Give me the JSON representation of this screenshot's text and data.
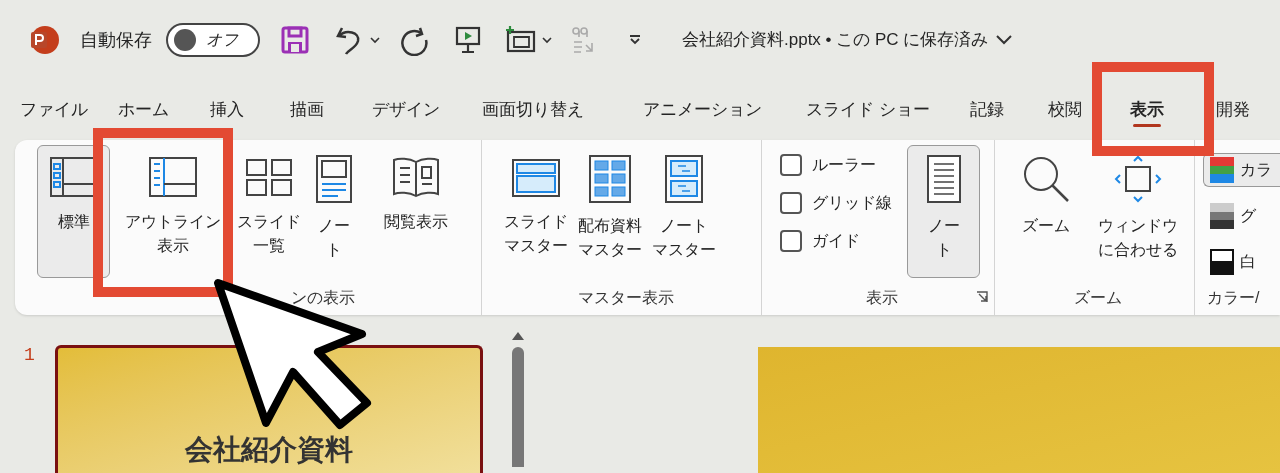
{
  "title_bar": {
    "autosave_label": "自動保存",
    "autosave_toggle": {
      "label": "オフ",
      "on": false
    },
    "file_title": "会社紹介資料.pptx • この PC に保存済み"
  },
  "tabs": [
    {
      "label": "ファイル",
      "selected": false
    },
    {
      "label": "ホーム",
      "selected": false
    },
    {
      "label": "挿入",
      "selected": false
    },
    {
      "label": "描画",
      "selected": false
    },
    {
      "label": "デザイン",
      "selected": false
    },
    {
      "label": "画面切り替え",
      "selected": false
    },
    {
      "label": "アニメーション",
      "selected": false
    },
    {
      "label": "スライド ショー",
      "selected": false
    },
    {
      "label": "記録",
      "selected": false
    },
    {
      "label": "校閲",
      "selected": false
    },
    {
      "label": "表示",
      "selected": true
    },
    {
      "label": "開発",
      "selected": false
    }
  ],
  "ribbon": {
    "groups": [
      {
        "label": "ンの表示",
        "items": [
          {
            "kind": "button",
            "lines": [
              "標準"
            ],
            "selected": true
          },
          {
            "kind": "button",
            "lines": [
              "アウトライン",
              "表示"
            ],
            "selected": false
          },
          {
            "kind": "button",
            "lines": [
              "スライド",
              "一覧"
            ],
            "selected": false
          },
          {
            "kind": "button",
            "lines": [
              "ノー",
              "ト"
            ],
            "selected": false
          },
          {
            "kind": "button",
            "lines": [
              "閲覧表示"
            ],
            "selected": false
          }
        ]
      },
      {
        "label": "マスター表示",
        "items": [
          {
            "kind": "button",
            "lines": [
              "スライド",
              "マスター"
            ],
            "selected": false
          },
          {
            "kind": "button",
            "lines": [
              "配布資料",
              "マスター"
            ],
            "selected": false
          },
          {
            "kind": "button",
            "lines": [
              "ノート",
              "マスター"
            ],
            "selected": false
          }
        ]
      },
      {
        "label": "表示",
        "items": [
          {
            "kind": "checkbox",
            "label": "ルーラー",
            "checked": false
          },
          {
            "kind": "checkbox",
            "label": "グリッド線",
            "checked": false
          },
          {
            "kind": "checkbox",
            "label": "ガイド",
            "checked": false
          },
          {
            "kind": "button",
            "lines": [
              "ノー",
              "ト"
            ],
            "selected": true
          }
        ]
      },
      {
        "label": "ズーム",
        "items": [
          {
            "kind": "button",
            "lines": [
              "ズーム"
            ],
            "selected": false
          },
          {
            "kind": "button",
            "lines": [
              "ウィンドウ",
              "に合わせる"
            ],
            "selected": false
          }
        ]
      },
      {
        "label": "カラー/",
        "items": [
          {
            "kind": "color-option",
            "label": "カラ",
            "selected": true
          },
          {
            "kind": "color-option",
            "label": "グ",
            "selected": false
          },
          {
            "kind": "color-option",
            "label": "白",
            "selected": false
          }
        ]
      }
    ]
  },
  "slides": [
    {
      "number": "1",
      "title": "会社紹介資料",
      "selected": true
    }
  ]
}
